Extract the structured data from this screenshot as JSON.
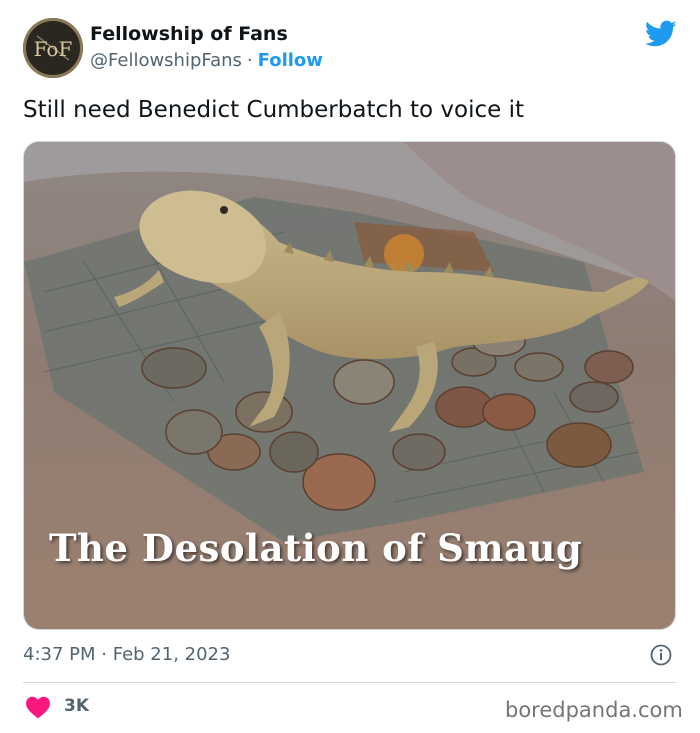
{
  "author": {
    "name": "Fellowship of Fans",
    "handle": "@FellowshipFans",
    "separator": "·",
    "follow_label": "Follow",
    "avatar_monogram": "FoF"
  },
  "tweet": {
    "text": "Still need Benedict Cumberbatch to voice it",
    "image_caption": "The Desolation of Smaug",
    "time": "4:37 PM",
    "date": "Feb 21, 2023",
    "like_count": "3K"
  },
  "watermark": "boredpanda.com",
  "icons": {
    "brand": "twitter-bird-icon",
    "info": "info-icon",
    "like": "heart-icon"
  },
  "colors": {
    "brand_blue": "#1d9bf0",
    "like_pink": "#f91880",
    "secondary_text": "#536471"
  }
}
